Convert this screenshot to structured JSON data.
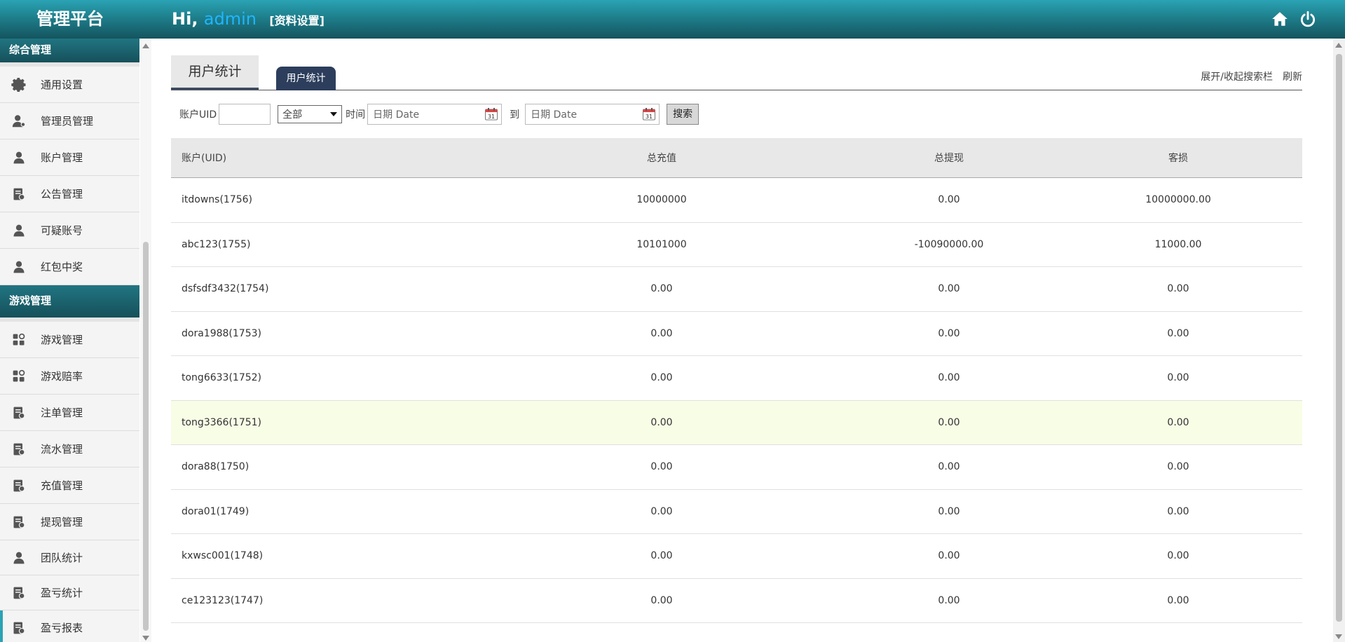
{
  "header": {
    "brand": "管理平台",
    "greeting_prefix": "Hi,",
    "username": "admin",
    "profile_link": "[资料设置]"
  },
  "sidebar": {
    "sections": [
      {
        "title": "综合管理",
        "items": [
          {
            "label": "通用设置",
            "icon": "gear-icon"
          },
          {
            "label": "管理员管理",
            "icon": "admin-user-icon"
          },
          {
            "label": "账户管理",
            "icon": "user-icon"
          },
          {
            "label": "公告管理",
            "icon": "document-icon"
          },
          {
            "label": "可疑账号",
            "icon": "user-icon"
          },
          {
            "label": "红包中奖",
            "icon": "user-icon"
          }
        ]
      },
      {
        "title": "游戏管理",
        "items": [
          {
            "label": "游戏管理",
            "icon": "apps-icon"
          },
          {
            "label": "游戏赔率",
            "icon": "apps-icon"
          },
          {
            "label": "注单管理",
            "icon": "document-icon"
          },
          {
            "label": "流水管理",
            "icon": "document-icon"
          },
          {
            "label": "充值管理",
            "icon": "document-icon"
          },
          {
            "label": "提现管理",
            "icon": "document-icon"
          },
          {
            "label": "团队统计",
            "icon": "user-icon"
          },
          {
            "label": "盈亏统计",
            "icon": "document-icon"
          },
          {
            "label": "盈亏报表",
            "icon": "document-icon"
          }
        ]
      }
    ]
  },
  "tabs": {
    "main_tab": "用户统计",
    "active_pill": "用户统计",
    "toggle_search": "展开/收起搜索栏",
    "refresh": "刷新"
  },
  "filters": {
    "uid_label": "账户UID",
    "uid_value": "",
    "type_selected": "全部",
    "time_label": "时间",
    "date_placeholder": "日期 Date",
    "to_label": "到",
    "search_button": "搜索"
  },
  "table": {
    "columns": [
      "账户(UID)",
      "总充值",
      "总提现",
      "客损"
    ],
    "rows": [
      [
        "itdowns(1756)",
        "10000000",
        "0.00",
        "10000000.00"
      ],
      [
        "abc123(1755)",
        "10101000",
        "-10090000.00",
        "11000.00"
      ],
      [
        "dsfsdf3432(1754)",
        "0.00",
        "0.00",
        "0.00"
      ],
      [
        "dora1988(1753)",
        "0.00",
        "0.00",
        "0.00"
      ],
      [
        "tong6633(1752)",
        "0.00",
        "0.00",
        "0.00"
      ],
      [
        "tong3366(1751)",
        "0.00",
        "0.00",
        "0.00"
      ],
      [
        "dora88(1750)",
        "0.00",
        "0.00",
        "0.00"
      ],
      [
        "dora01(1749)",
        "0.00",
        "0.00",
        "0.00"
      ],
      [
        "kxwsc001(1748)",
        "0.00",
        "0.00",
        "0.00"
      ],
      [
        "ce123123(1747)",
        "0.00",
        "0.00",
        "0.00"
      ]
    ]
  },
  "colors": {
    "header_gradient_top": "#2aa3b4",
    "header_gradient_bottom": "#14545e",
    "username": "#1fb6ff",
    "pill_tab": "#2c3e5c",
    "highlight_row": "#f8fde6"
  }
}
